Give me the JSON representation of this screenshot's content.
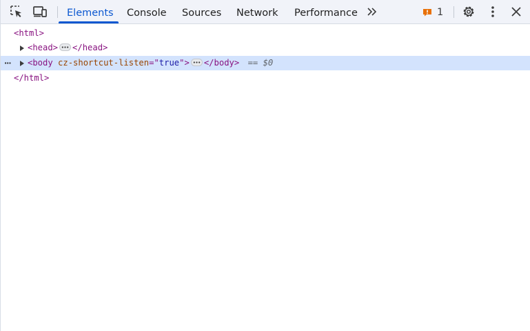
{
  "toolbar": {
    "icons": {
      "inspect": "inspect-element-icon",
      "device": "device-toolbar-icon",
      "more_tabs": "chevron-double-right-icon",
      "issue": "issue-flag-icon",
      "settings": "gear-icon",
      "menu": "kebab-menu-icon",
      "close": "close-icon"
    },
    "tabs": [
      {
        "label": "Elements",
        "active": true
      },
      {
        "label": "Console",
        "active": false
      },
      {
        "label": "Sources",
        "active": false
      },
      {
        "label": "Network",
        "active": false
      },
      {
        "label": "Performance",
        "active": false
      }
    ],
    "issues_count": "1"
  },
  "tree": {
    "html_open": "<html>",
    "head_open": "<head>",
    "head_close": "</head>",
    "body_open_tag": "<body",
    "body_attr_name": "cz-shortcut-listen",
    "body_attr_eq": "=\"",
    "body_attr_value": "true",
    "body_attr_quote_close": "\">",
    "body_close": "</body>",
    "selected_marker": "== $0",
    "html_close": "</html>",
    "row_menu_dots": "···"
  },
  "colors": {
    "accent": "#0b57d0",
    "selection": "#d3e3fd",
    "tag": "#881280",
    "attr_name": "#994500",
    "attr_value": "#1a1aa6",
    "issue": "#e8710a"
  }
}
